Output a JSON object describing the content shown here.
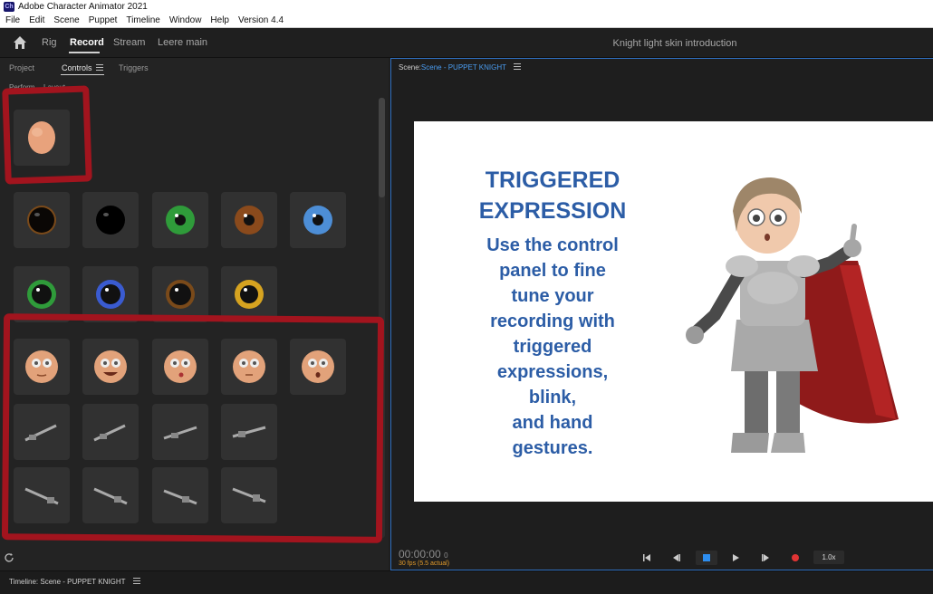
{
  "titlebar": {
    "icon_text": "Ch",
    "title": "Adobe Character Animator 2021"
  },
  "menu": [
    "File",
    "Edit",
    "Scene",
    "Puppet",
    "Timeline",
    "Window",
    "Help",
    "Version 4.4"
  ],
  "workspace": {
    "tabs": [
      "Rig",
      "Record",
      "Stream",
      "Leere main"
    ],
    "active_tab": "Record",
    "title": "Knight light skin introduction",
    "icons": [
      "home-icon"
    ]
  },
  "left_panel": {
    "tabs": [
      "Project",
      "Controls",
      "Triggers"
    ],
    "active_tab": "Controls",
    "subtabs": [
      "Perform",
      "Layout"
    ],
    "tiles": {
      "head": [
        "head"
      ],
      "eyes_row1": [
        "#1a120a",
        "#0d0d0d",
        "#2f9b3a",
        "#8a4a1c",
        "#4d8ed6"
      ],
      "eyes_row2": [
        "#2f9b3a",
        "#3a5bd0",
        "#5a3410",
        "#d6a320"
      ],
      "faces": [
        "neutral",
        "smile",
        "kiss",
        "neutral",
        "surprised"
      ],
      "swords_row1": 4,
      "swords_row2": 4
    },
    "icons": [
      "refresh-icon"
    ]
  },
  "scene": {
    "label": "Scene:",
    "name": "Scene - PUPPET KNIGHT",
    "slide_title_line1": "TRIGGERED",
    "slide_title_line2": "EXPRESSION",
    "slide_body": [
      "Use the control",
      "panel to fine",
      "tune your",
      "recording with",
      "triggered",
      "expressions,",
      "blink,",
      "and hand",
      "gestures."
    ],
    "timecode": "00:00:00",
    "frame": "0",
    "fps": "30 fps (5.5 actual)",
    "speed": "1.0x",
    "colors": {
      "accent": "#2c5da6",
      "record": "#e03434",
      "stop": "#2d8ef0"
    }
  },
  "timeline": {
    "title": "Timeline: Scene - PUPPET KNIGHT"
  }
}
